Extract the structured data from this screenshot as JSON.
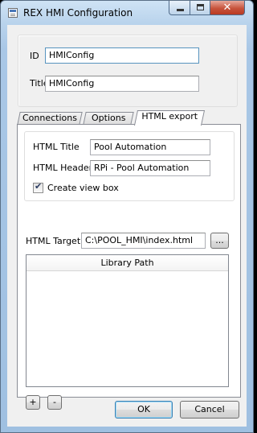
{
  "window": {
    "title": "REX HMI Configuration",
    "close_symbol": "✕"
  },
  "general": {
    "id_label": "ID",
    "id_value": "HMIConfig",
    "title_label": "Title",
    "title_value": "HMIConfig"
  },
  "tabs": [
    {
      "label": "Connections",
      "active": false
    },
    {
      "label": "Options",
      "active": false
    },
    {
      "label": "HTML export",
      "active": true
    }
  ],
  "html_export": {
    "html_title_label": "HTML Title",
    "html_title_value": "Pool Automation",
    "html_header_label": "HTML Header",
    "html_header_value": "RPi - Pool Automation",
    "create_view_box_label": "Create view box",
    "create_view_box_checked": true,
    "html_target_label": "HTML Target",
    "html_target_value": "C:\\POOL_HMI\\index.html",
    "browse_label": "...",
    "library_path_header": "Library Path",
    "add_label": "+",
    "remove_label": "-"
  },
  "footer": {
    "ok_label": "OK",
    "cancel_label": "Cancel"
  },
  "icons": [
    "app-icon",
    "minimize-icon",
    "maximize-icon",
    "close-icon",
    "checkmark-icon"
  ]
}
